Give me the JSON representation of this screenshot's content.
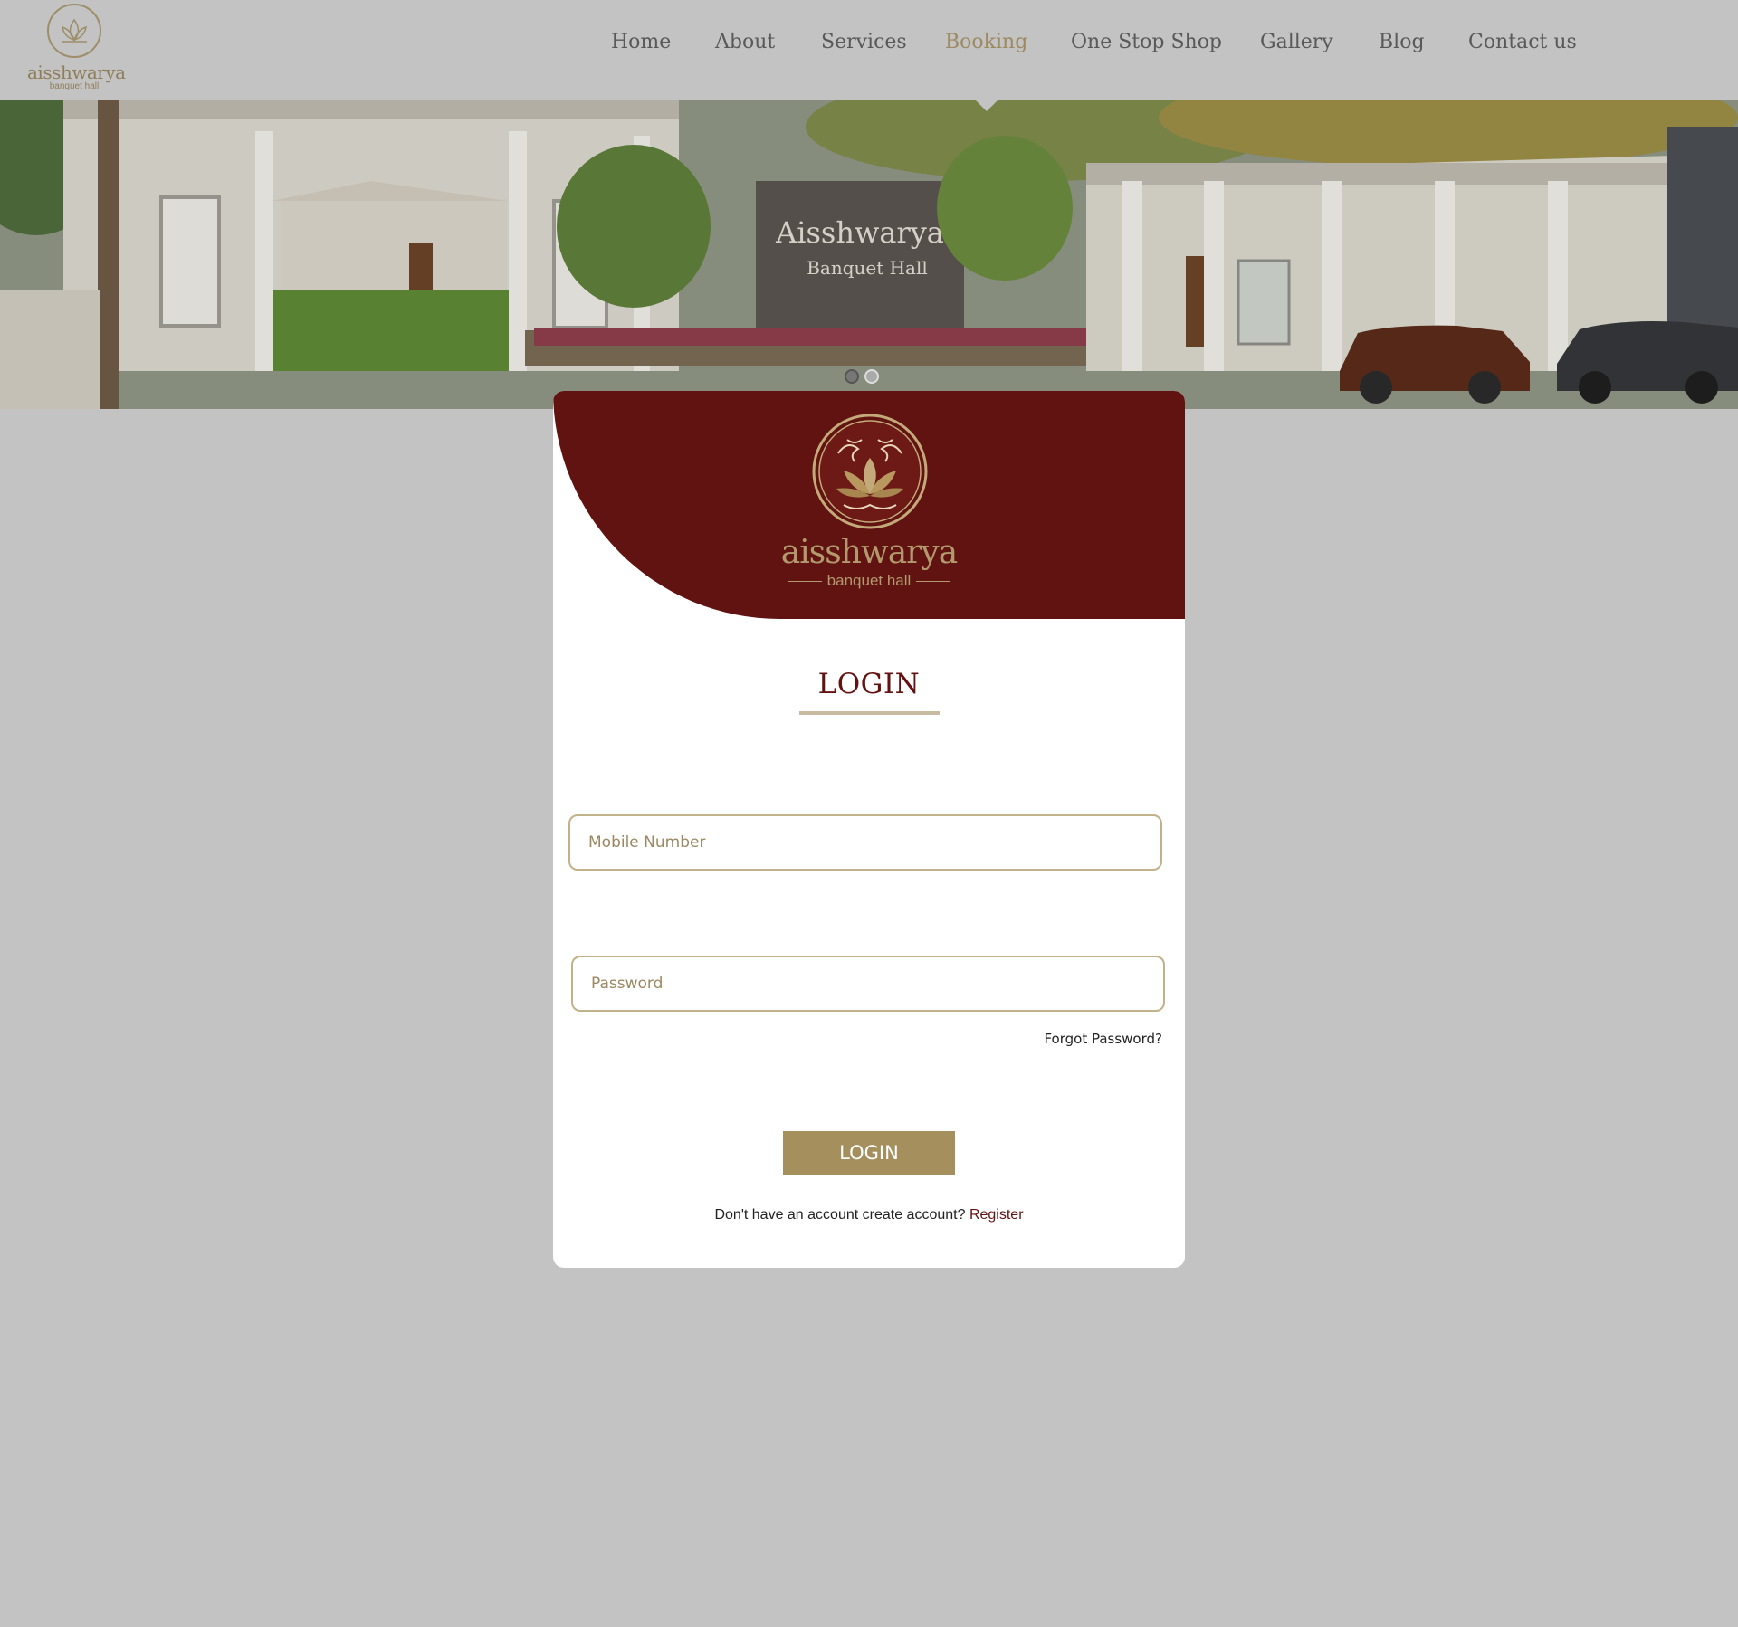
{
  "brand": {
    "name": "aisshwarya",
    "subtitle": "banquet hall"
  },
  "nav": {
    "items": [
      {
        "label": "Home"
      },
      {
        "label": "About"
      },
      {
        "label": "Services"
      },
      {
        "label": "Booking",
        "active": true
      },
      {
        "label": "One Stop Shop"
      },
      {
        "label": "Gallery"
      },
      {
        "label": "Blog"
      },
      {
        "label": "Contact us"
      }
    ]
  },
  "hero": {
    "sign_title": "Aisshwarya",
    "sign_subtitle": "Banquet Hall",
    "slides": 2,
    "active_slide": 2
  },
  "card": {
    "logo_name": "aisshwarya",
    "logo_subtitle": "banquet hall",
    "title": "LOGIN",
    "mobile_placeholder": "Mobile Number",
    "password_placeholder": "Password",
    "forgot_label": "Forgot Password?",
    "login_button": "LOGIN",
    "register_prompt": "Don't have an account create account?",
    "register_link": "Register"
  },
  "colors": {
    "page_bg": "#c3c3c3",
    "brand_maroon": "#601311",
    "gold": "#a48f5d",
    "nav_text": "#595959",
    "nav_active": "#9c8a62"
  }
}
